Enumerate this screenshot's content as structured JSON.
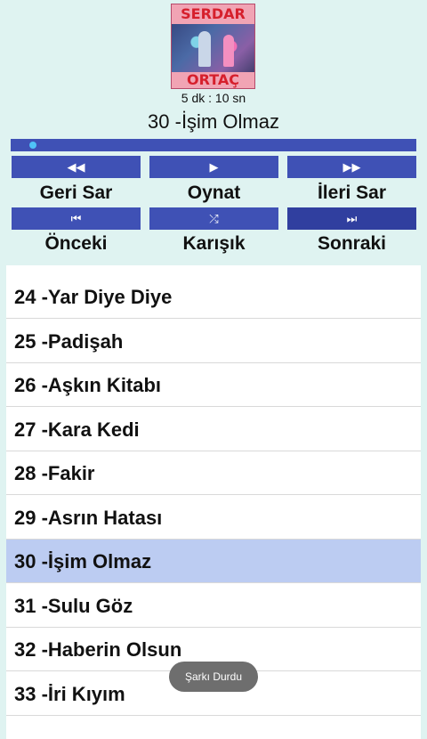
{
  "header": {
    "cover": {
      "artist_top": "SERDAR",
      "artist_bottom": "ORTAÇ"
    },
    "duration": "5 dk : 10 sn",
    "now_playing": "30 -İşim Olmaz",
    "seek_progress_fraction": 0.02
  },
  "controls": {
    "rewind": {
      "icon": "rewind-icon",
      "glyph": "◀◀",
      "label": "Geri Sar"
    },
    "play": {
      "icon": "play-icon",
      "glyph": "▶",
      "label": "Oynat"
    },
    "forward": {
      "icon": "fast-forward-icon",
      "glyph": "▶▶",
      "label": "İleri Sar"
    },
    "previous": {
      "icon": "skip-previous-icon",
      "glyph": "⏮",
      "label": "Önceki"
    },
    "shuffle": {
      "icon": "shuffle-icon",
      "glyph": "⤮",
      "label": "Karışık"
    },
    "next": {
      "icon": "skip-next-icon",
      "glyph": "⏭",
      "label": "Sonraki"
    }
  },
  "playlist": {
    "items": [
      "24 -Yar Diye Diye",
      "25 -Padişah",
      "26 -Aşkın Kitabı",
      "27 -Kara Kedi",
      "28 -Fakir",
      "29 -Asrın Hatası",
      "30 -İşim Olmaz",
      "31 -Sulu Göz",
      "32 -Haberin Olsun",
      "33 -İri Kıyım"
    ],
    "selected_index": 6
  },
  "toast": {
    "text": "Şarkı Durdu"
  },
  "colors": {
    "accent": "#3f51b5",
    "accent_dark": "#303f9f",
    "selected_row": "#bcccf2",
    "background": "#dff3f1"
  }
}
